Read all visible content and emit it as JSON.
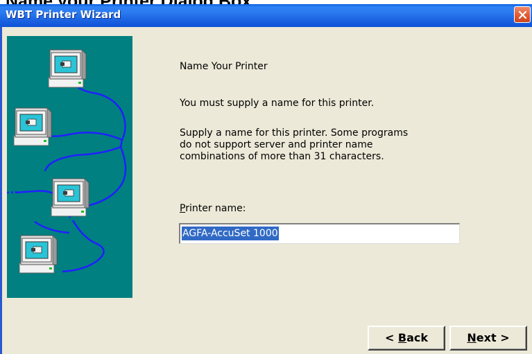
{
  "document_caption": "Name your Printer Dialog Box",
  "window": {
    "title": "WBT Printer Wizard",
    "close_icon": "close-icon"
  },
  "banner": {
    "illustration": "networked-computers-illustration",
    "background_color": "#008080",
    "line_color": "#2020ff"
  },
  "content": {
    "heading": "Name Your Printer",
    "instruction": "You must supply a name for this printer.",
    "description": "Supply a name for this printer. Some programs do not support server and printer name combinations of more than 31 characters.",
    "field_label_prefix": "P",
    "field_label_rest": "rinter name:",
    "printer_name_value": "AGFA-AccuSet 1000"
  },
  "buttons": {
    "back_prefix": "< ",
    "back_access": "B",
    "back_rest": "ack",
    "next_access": "N",
    "next_rest": "ext >"
  },
  "colors": {
    "titlebar": "#2b7bef",
    "dialog_face": "#ece9d8",
    "selection": "#316ac5"
  }
}
